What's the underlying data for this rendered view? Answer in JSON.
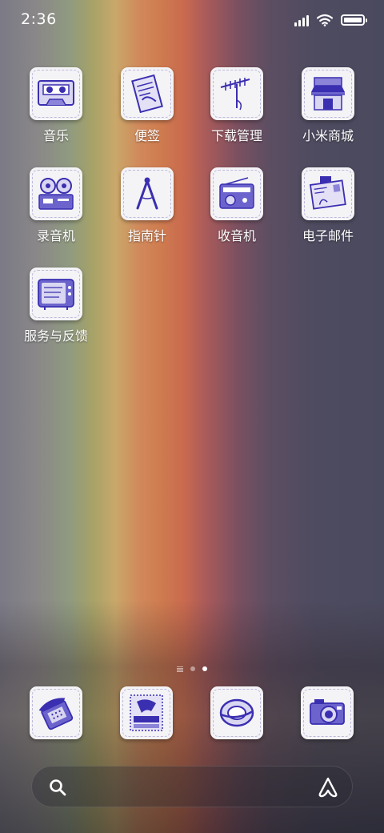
{
  "status": {
    "time": "2:36",
    "icons": [
      "signal-icon",
      "wifi-icon",
      "battery-icon"
    ],
    "battery_level": 1.0
  },
  "apps": [
    {
      "label": "音乐",
      "icon": "cassette-icon"
    },
    {
      "label": "便签",
      "icon": "notepad-icon"
    },
    {
      "label": "下载管理",
      "icon": "antenna-icon"
    },
    {
      "label": "小米商城",
      "icon": "store-icon"
    },
    {
      "label": "录音机",
      "icon": "reel-recorder-icon"
    },
    {
      "label": "指南针",
      "icon": "compass-icon"
    },
    {
      "label": "收音机",
      "icon": "radio-icon"
    },
    {
      "label": "电子邮件",
      "icon": "letter-icon"
    },
    {
      "label": "服务与反馈",
      "icon": "tv-icon"
    }
  ],
  "page_indicator": {
    "pages": 2,
    "current": 2
  },
  "dock": [
    {
      "icon": "telephone-icon"
    },
    {
      "icon": "stamp-icon"
    },
    {
      "icon": "orbit-icon"
    },
    {
      "icon": "camera-icon"
    }
  ],
  "search": {
    "icons": [
      "search-icon",
      "assistant-icon"
    ]
  },
  "colors": {
    "icon_ink": "#3a2fb0",
    "icon_paper": "#f4f3f6"
  }
}
